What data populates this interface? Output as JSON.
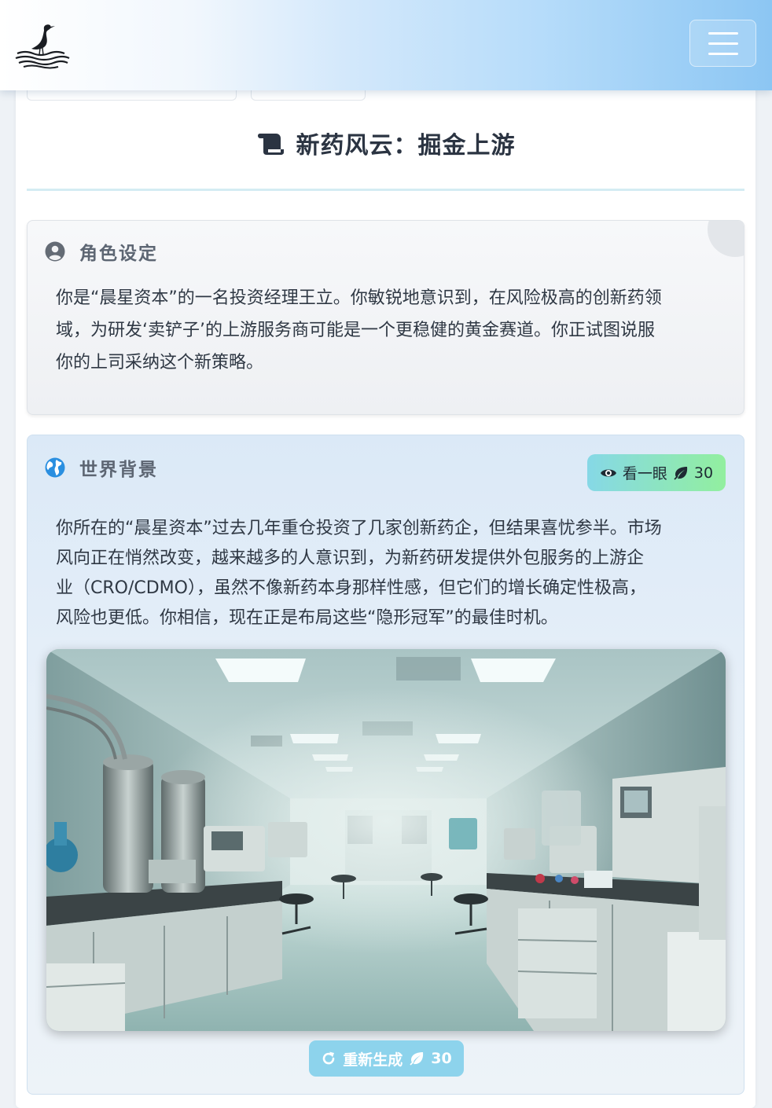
{
  "title": "新药风云：掘金上游",
  "role": {
    "heading": "角色设定",
    "lines": [
      "你是“晨星资本”的一名投资经理王立。你敏锐地意识到，在风险极高的创新药领",
      "域，为研发‘卖铲子’的上游服务商可能是一个更稳健的黄金赛道。你正试图说服",
      "你的上司采纳这个新策略。"
    ]
  },
  "world": {
    "heading": "世界背景",
    "peek_label": "看一眼",
    "peek_cost": "30",
    "lines": [
      "你所在的“晨星资本”过去几年重仓投资了几家创新药企，但结果喜忧参半。市场",
      "风向正在悄然改变，越来越多的人意识到，为新药研发提供外包服务的上游企",
      "业（CRO/CDMO），虽然不像新药本身那样性感，但它们的增长确定性极高，",
      "风险也更低。你相信，现在正是布局这些“隐形冠军”的最佳时机。"
    ],
    "regen_label": "重新生成",
    "regen_cost": "30"
  },
  "icons": {
    "logo": "heron-logo",
    "menu": "hamburger-icon",
    "title": "scroll-icon",
    "role": "user-circle-icon",
    "world": "globe-icon",
    "peek": "eye-icon",
    "cost": "leaf-icon",
    "regen": "redo-icon"
  },
  "colors": {
    "header_gradient_end": "#8cc6f3",
    "peek_gradient_start": "#86d8e6",
    "peek_gradient_end": "#92ef9f",
    "regen_button": "#8dd3ec",
    "divider": "#d4ecf3"
  }
}
